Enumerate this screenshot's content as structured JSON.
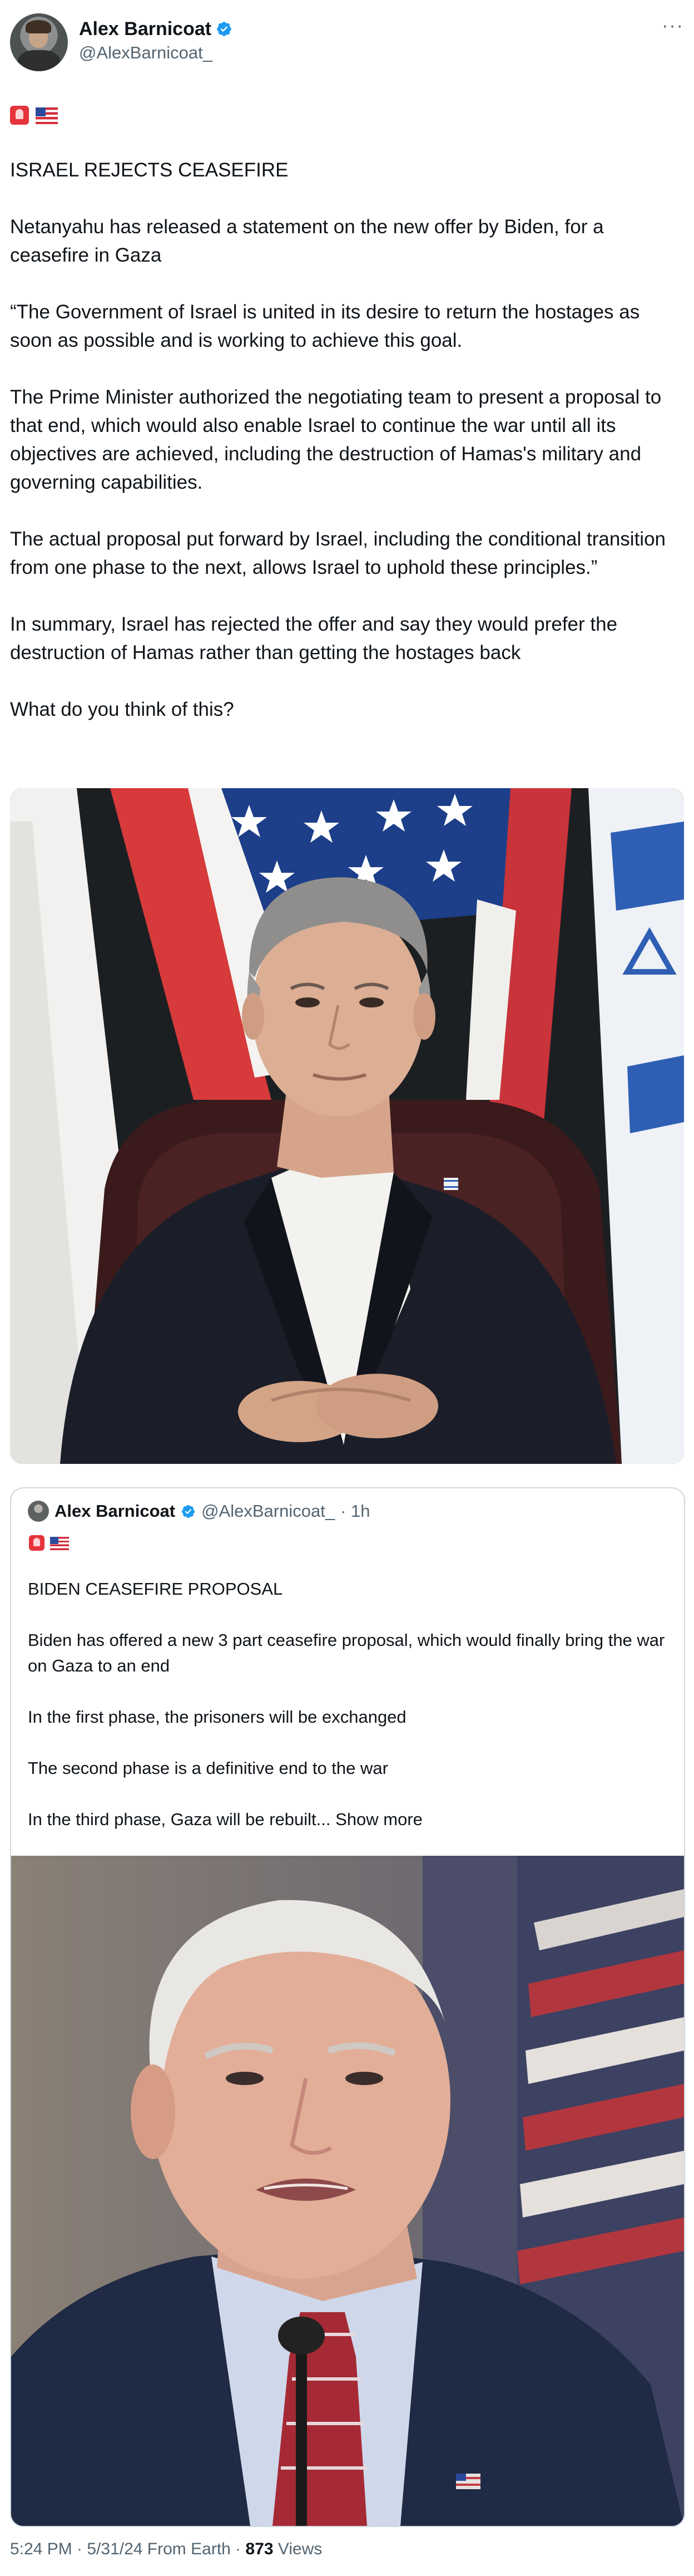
{
  "author": {
    "name": "Alex Barnicoat",
    "handle": "@AlexBarnicoat_"
  },
  "icons": {
    "verified": "verified-badge-icon",
    "more": "more-options-icon",
    "siren": "police-light-emoji",
    "flag": "us-flag-emoji"
  },
  "colors": {
    "verified_blue": "#1d9bf0",
    "text_primary": "#0f1419",
    "text_secondary": "#536471",
    "border": "#cfd9de"
  },
  "tweet": {
    "text": "ISRAEL REJECTS CEASEFIRE\n\nNetanyahu has released a statement on the new offer by Biden, for a ceasefire in Gaza\n\n“The Government of Israel is united in its desire to return the hostages as soon as possible and is working to achieve this goal.\n\nThe Prime Minister authorized the negotiating team to present a proposal to that end, which would also enable Israel to continue the war until all its objectives are achieved, including the destruction of Hamas's military and governing capabilities.\n\nThe actual proposal put forward by Israel, including the conditional transition from one phase to the next, allows Israel to uphold these principles.”\n\nIn summary, Israel has rejected the offer and say they would prefer the destruction of Hamas rather than getting the hostages back\n\nWhat do you think of this?"
  },
  "quoted_tweet": {
    "name": "Alex Barnicoat",
    "handle": "@AlexBarnicoat_",
    "time": "· 1h",
    "text": "BIDEN CEASEFIRE PROPOSAL\n\nBiden has offered a new 3 part ceasefire proposal, which would finally bring the war on Gaza to an end\n\nIn the first phase, the prisoners will be exchanged\n\nThe second phase is a definitive end to the war\n\nIn the third phase, Gaza will be rebuilt...",
    "show_more": "Show more"
  },
  "footer": {
    "timestamp": "5:24 PM · 5/31/24 From Earth ·",
    "views_count": "873",
    "views_label": "Views"
  }
}
